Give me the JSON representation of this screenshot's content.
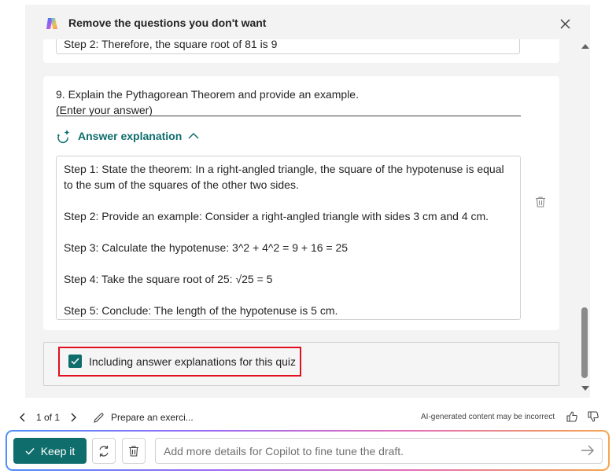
{
  "header": {
    "title": "Remove the questions you don't want",
    "logo_icon": "copilot-logo-icon",
    "close_icon": "close-icon"
  },
  "previous_card": {
    "step_text": "Step 2: Therefore, the square root of 81 is 9"
  },
  "question_card": {
    "question": "9. Explain the Pythagorean Theorem and provide an example.",
    "answer_placeholder": "(Enter your answer)",
    "explanation_label": "Answer explanation",
    "explanation_text": "Step 1: State the theorem: In a right-angled triangle, the square of the hypotenuse is equal to the sum of the squares of the other two sides.\n\nStep 2: Provide an example: Consider a right-angled triangle with sides 3 cm and 4 cm.\n\nStep 3: Calculate the hypotenuse: 3^2 + 4^2 = 9 + 16 = 25\n\nStep 4: Take the square root of 25: √25 = 5\n\nStep 5: Conclude: The length of the hypotenuse is 5 cm.",
    "delete_icon": "trash-icon"
  },
  "include_option": {
    "label": "Including answer explanations for this quiz",
    "checked": true
  },
  "footer": {
    "page_indicator": "1 of 1",
    "draft_title": "Prepare an exerci...",
    "ai_note": "AI-generated content may be incorrect"
  },
  "composer": {
    "keep_label": "Keep it",
    "input_placeholder": "Add more details for Copilot to fine tune the draft."
  },
  "colors": {
    "accent": "#0f6d6c",
    "highlight": "#e0101e",
    "panel_bg": "#f3f3f3"
  }
}
